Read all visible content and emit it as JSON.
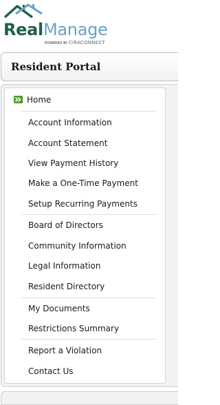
{
  "brand": {
    "real": "Real",
    "manage": "Manage",
    "powered_by": "POWERED BY",
    "cira": "CIRACONNECT"
  },
  "portal": {
    "title": "Resident Portal"
  },
  "nav": {
    "home": "Home",
    "items": [
      "Account Information",
      "Account Statement",
      "View Payment History",
      "Make a One-Time Payment",
      "Setup Recurring Payments",
      "Board of Directors",
      "Community Information",
      "Legal Information",
      "Resident Directory",
      "My Documents",
      "Restrictions Summary",
      "Report a Violation",
      "Contact Us"
    ]
  },
  "colors": {
    "brand_green": "#1f5f49",
    "brand_blue": "#6aa1c5",
    "home_icon": "#4f9a2e"
  },
  "icons": {
    "logo": "house-roof-icon",
    "home": "double-chevron-right-icon"
  }
}
